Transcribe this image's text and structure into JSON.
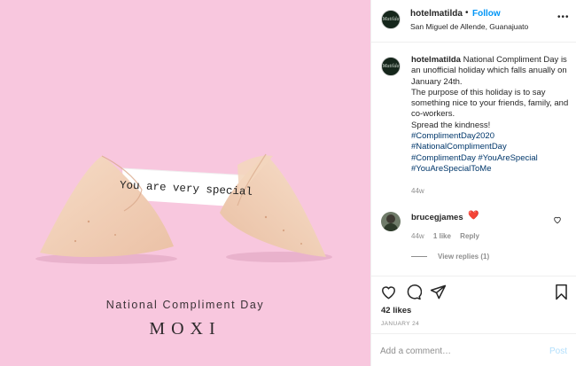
{
  "image": {
    "fortune_text": "You are very special",
    "caption_title": "National Compliment Day",
    "caption_brand": "MOXI",
    "background_color": "#f8c7de"
  },
  "header": {
    "username": "hotelmatilda",
    "separator": "•",
    "follow_label": "Follow",
    "location": "San Miguel de Allende, Guanajuato",
    "more_label": "•••"
  },
  "post": {
    "username": "hotelmatilda",
    "lines": [
      "National Compliment Day is an unofficial holiday which falls anually on January 24th.",
      "The purpose of this holiday is to say something nice to your friends, family, and co-workers.",
      "Spread the kindness!"
    ],
    "hashtags": [
      "#ComplimentDay2020",
      "#NationalComplimentDay",
      "#ComplimentDay #YouAreSpecial",
      "#YouAreSpecialToMe"
    ],
    "age": "44w"
  },
  "comment": {
    "username": "brucegjames",
    "emoji": "❤️",
    "age": "44w",
    "likes": "1 like",
    "reply": "Reply",
    "view_replies": "View replies (1)"
  },
  "actions": {
    "likes": "42 likes",
    "date": "JANUARY 24"
  },
  "add_comment": {
    "placeholder": "Add a comment…",
    "post_label": "Post"
  },
  "colors": {
    "accent": "#0095f6",
    "hashtag": "#00376b",
    "muted": "#8e8e8e",
    "post_disabled": "#b2dffc"
  },
  "icons": {
    "like": "heart-icon",
    "comment": "comment-icon",
    "share": "paper-plane-icon",
    "save": "bookmark-icon",
    "more": "more-options-icon",
    "comment_like": "heart-outline-icon"
  }
}
